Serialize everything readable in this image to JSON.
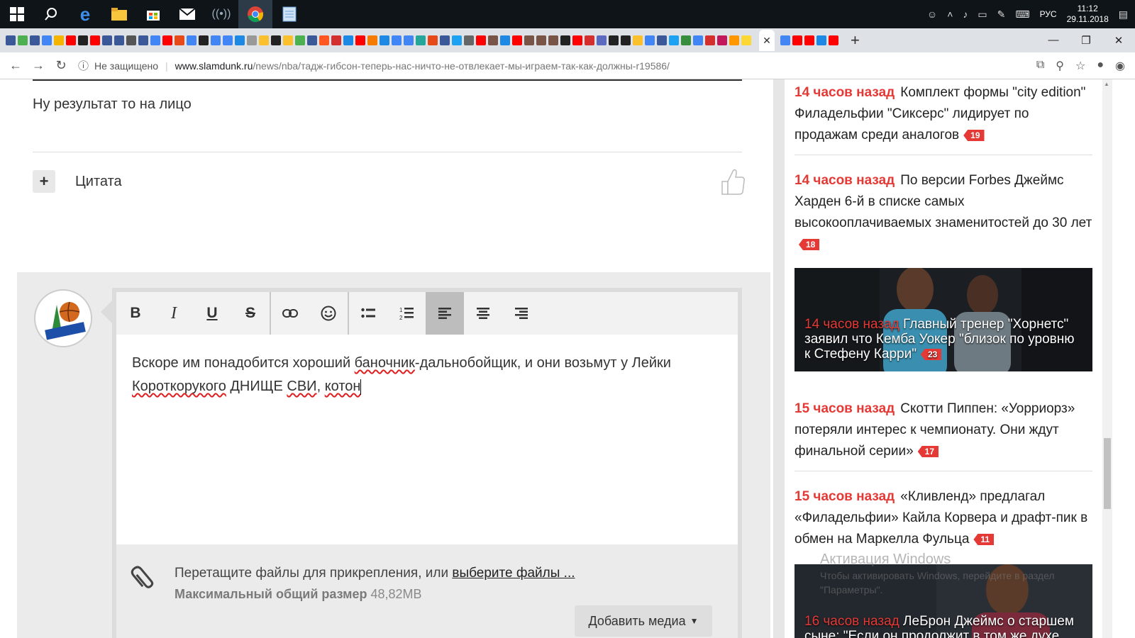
{
  "taskbar": {
    "clock_time": "11:12",
    "clock_date": "29.11.2018",
    "language": "РУС"
  },
  "browser": {
    "address": {
      "security_label": "Не защищено",
      "host": "www.slamdunk.ru",
      "path": "/news/nba/тадж-гибсон-теперь-нас-ничто-не-отвлекает-мы-играем-так-как-должны-r19586/"
    },
    "tab_favicon_colors": [
      "#3b5998",
      "#4caf50",
      "#3b5998",
      "#4285f4",
      "#f4b400",
      "#ff0000",
      "#222",
      "#ff0000",
      "#3b5998",
      "#3b5998",
      "#555",
      "#3b5998",
      "#4285f4",
      "#ff0000",
      "#e64a19",
      "#4285f4",
      "#222",
      "#4285f4",
      "#4285f4",
      "#1e88e5",
      "#999",
      "#fbc02d",
      "#222",
      "#fbc02d",
      "#4caf50",
      "#3b5998",
      "#ff5722",
      "#d32f2f",
      "#1e88e5",
      "#ff0000",
      "#f57c00",
      "#1e88e5",
      "#4285f4",
      "#4285f4",
      "#26a69a",
      "#e64a19",
      "#3b5998",
      "#1da1f2",
      "#666",
      "#ff0000",
      "#795548",
      "#1e88e5",
      "#ff0000",
      "#795548",
      "#795548",
      "#795548",
      "#222",
      "#ff0000",
      "#d32f2f",
      "#5c6bc0",
      "#222",
      "#222",
      "#fbc02d",
      "#4285f4",
      "#3b5998",
      "#1da1f2",
      "#388e3c",
      "#4285f4",
      "#d32f2f",
      "#c2185b",
      "#ff9800",
      "#fdd835"
    ],
    "tab_favicon_colors_after": [
      "#4285f4",
      "#ff0000",
      "#ff0000",
      "#1e88e5",
      "#ff0000"
    ]
  },
  "comment": {
    "text": "Ну результат то на лицо",
    "quote_label": "Цитата"
  },
  "editor": {
    "toolbar": {
      "bold": "B",
      "italic": "I",
      "underline": "U",
      "strike": "S",
      "link": "⊂⊃",
      "emoji": "☺",
      "bullets": "☰",
      "numbered": "☷",
      "align_left": "≡",
      "align_center": "≡",
      "align_right": "≡"
    },
    "text_parts": {
      "p1": "Вскоре им понадобится хороший ",
      "w1": "баночник",
      "p2": "-дальнобойщик, и они возьмут у Лейки ",
      "w2": "Короткорукого",
      "p3": " ДНИЩЕ ",
      "w3": "СВИ",
      "p4": ", ",
      "w4": "котон"
    },
    "attach_text": "Перетащите файлы для прикрепления, или ",
    "attach_link": "выберите файлы ...",
    "max_size_label": "Максимальный общий размер",
    "max_size_value": "48,82MB",
    "add_media_label": "Добавить медиа"
  },
  "sidebar": {
    "news": [
      {
        "time": "14 часов назад",
        "title": "Комплект формы \"city edition\" Филадельфии \"Сиксерс\" лидирует по продажам среди аналогов",
        "count": "19"
      },
      {
        "time": "14 часов назад",
        "title": "По версии Forbes Джеймс Харден 6-й в списке самых высокооплачиваемых знаменитостей до 30 лет",
        "count": "18"
      },
      {
        "time": "14 часов назад",
        "title": "Главный тренер \"Хорнетс\" заявил что Кемба Уокер \"близок по уровню к Стефену Карри\"",
        "count": "23"
      },
      {
        "time": "15 часов назад",
        "title": "Скотти Пиппен: «Уорриорз» потеряли интерес к чемпионату. Они ждут финальной серии»",
        "count": "17"
      },
      {
        "time": "15 часов назад",
        "title": "«Кливленд» предлагал «Филадельфии» Кайла Корвера и драфт-пик в обмен на Маркелла Фульца",
        "count": "11"
      },
      {
        "time": "16 часов назад",
        "title": "ЛеБрон Джеймс о старшем сыне: \"Если он продолжит в том же духе,"
      }
    ]
  },
  "watermark": {
    "title": "Активация Windows",
    "subtitle": "Чтобы активировать Windows, перейдите в раздел \"Параметры\"."
  }
}
